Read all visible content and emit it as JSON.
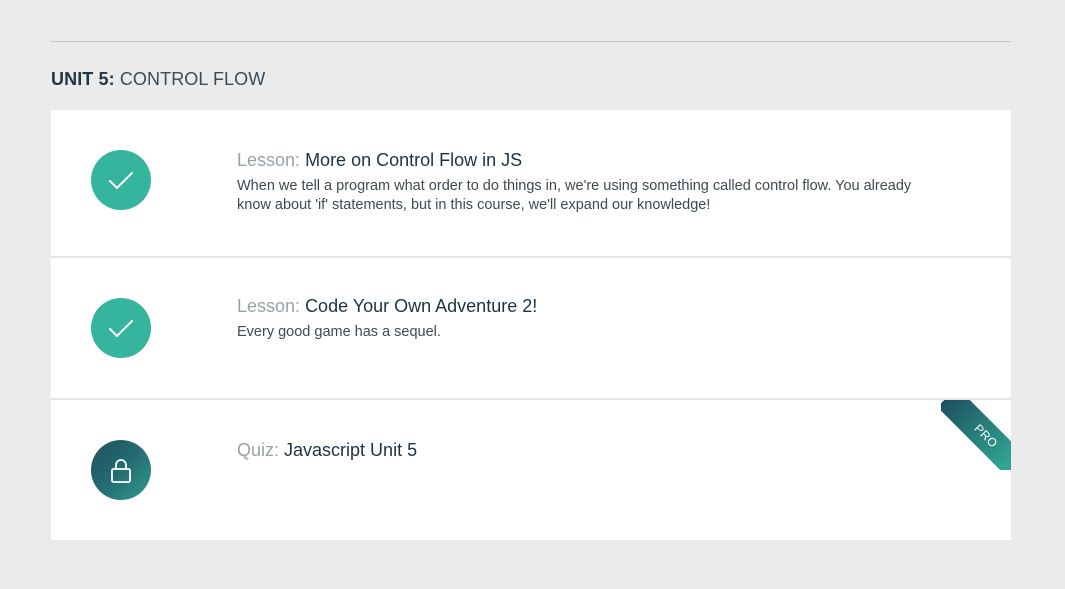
{
  "unit": {
    "label": "UNIT 5:",
    "name": "CONTROL FLOW"
  },
  "items": [
    {
      "kind": "Lesson:",
      "title": "More on Control Flow in JS",
      "description": "When we tell a program what order to do things in, we're using something called control flow. You already know about 'if' statements, but in this course, we'll expand our knowledge!",
      "status_icon": "checkmark-icon",
      "status": "completed"
    },
    {
      "kind": "Lesson:",
      "title": "Code Your Own Adventure 2!",
      "description": "Every good game has a sequel.",
      "status_icon": "checkmark-icon",
      "status": "completed"
    },
    {
      "kind": "Quiz:",
      "title": "Javascript Unit 5",
      "description": "",
      "status_icon": "lock-icon",
      "status": "locked",
      "badge": "PRO"
    }
  ],
  "colors": {
    "page_background": "#ebebeb",
    "card_background": "#ffffff",
    "completed_accent": "#35b49e",
    "locked_accent": "#256c72",
    "heading_text": "#213745"
  }
}
